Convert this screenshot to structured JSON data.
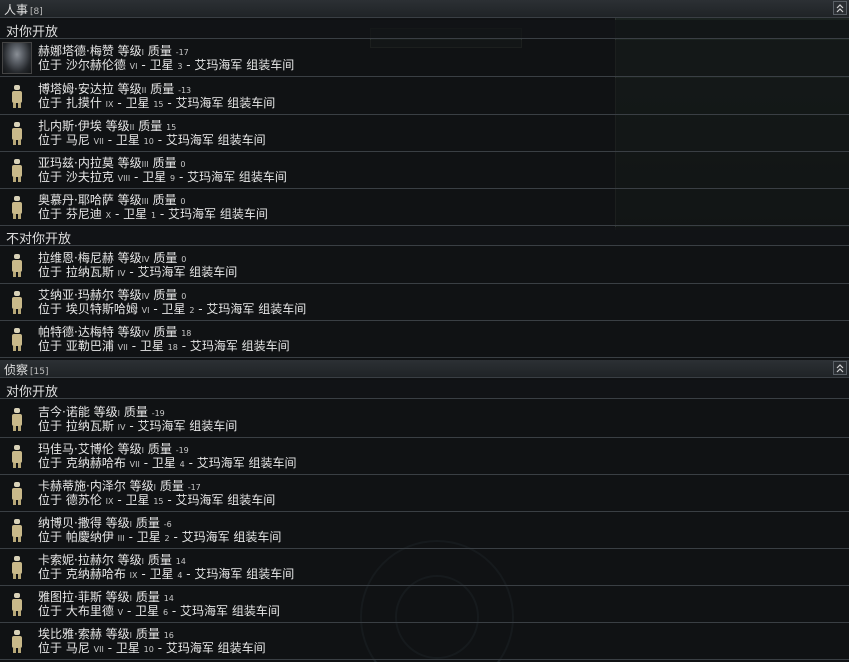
{
  "sections": [
    {
      "title": "人事",
      "count": "[8]",
      "groups": [
        {
          "label": "对你开放",
          "rows": [
            {
              "name": "赫娜塔德·梅赞",
              "lvl_label": "等级",
              "lvl": "I",
              "q_label": "质量",
              "q": "-17",
              "loc": "位于 沙尔赫伦德",
              "roman": "VI",
              "sat": "- 卫星",
              "satnum": "3",
              "tail": "- 艾玛海军 组装车间",
              "portrait": true
            },
            {
              "name": "博塔姆·安达拉",
              "lvl_label": "等级",
              "lvl": "II",
              "q_label": "质量",
              "q": "-13",
              "loc": "位于 扎摸什",
              "roman": "IX",
              "sat": "- 卫星",
              "satnum": "15",
              "tail": "- 艾玛海军 组装车间"
            },
            {
              "name": "扎内斯·伊埃",
              "lvl_label": "等级",
              "lvl": "II",
              "q_label": "质量",
              "q": "15",
              "loc": "位于 马尼",
              "roman": "VII",
              "sat": "- 卫星",
              "satnum": "10",
              "tail": "- 艾玛海军 组装车间"
            },
            {
              "name": "亚玛兹·内拉莫",
              "lvl_label": "等级",
              "lvl": "III",
              "q_label": "质量",
              "q": "0",
              "loc": "位于 沙夫拉克",
              "roman": "VIII",
              "sat": "- 卫星",
              "satnum": "9",
              "tail": "- 艾玛海军 组装车间"
            },
            {
              "name": "奥慕丹·耶哈萨",
              "lvl_label": "等级",
              "lvl": "III",
              "q_label": "质量",
              "q": "0",
              "loc": "位于 芬尼迪",
              "roman": "X",
              "sat": "- 卫星",
              "satnum": "1",
              "tail": "- 艾玛海军 组装车间"
            }
          ]
        },
        {
          "label": "不对你开放",
          "rows": [
            {
              "name": "拉维恩·梅尼赫",
              "lvl_label": "等级",
              "lvl": "IV",
              "q_label": "质量",
              "q": "0",
              "loc": "位于 拉纳瓦斯",
              "roman": "IV",
              "sat": "- 艾玛海军 组装车间",
              "satnum": "",
              "tail": ""
            },
            {
              "name": "艾纳亚·玛赫尔",
              "lvl_label": "等级",
              "lvl": "IV",
              "q_label": "质量",
              "q": "0",
              "loc": "位于 埃贝特斯哈姆",
              "roman": "VI",
              "sat": "- 卫星",
              "satnum": "2",
              "tail": "- 艾玛海军 组装车间"
            },
            {
              "name": "帕特德·达梅特",
              "lvl_label": "等级",
              "lvl": "IV",
              "q_label": "质量",
              "q": "18",
              "loc": "位于 亚勒巴浦",
              "roman": "VII",
              "sat": "- 卫星",
              "satnum": "18",
              "tail": "- 艾玛海军 组装车间"
            }
          ]
        }
      ]
    },
    {
      "title": "侦察",
      "count": "[15]",
      "groups": [
        {
          "label": "对你开放",
          "rows": [
            {
              "name": "吉今·诺能",
              "lvl_label": "等级",
              "lvl": "I",
              "q_label": "质量",
              "q": "-19",
              "loc": "位于 拉纳瓦斯",
              "roman": "IV",
              "sat": "- 艾玛海军 组装车间",
              "satnum": "",
              "tail": ""
            },
            {
              "name": "玛佳马·艾博伦",
              "lvl_label": "等级",
              "lvl": "I",
              "q_label": "质量",
              "q": "-19",
              "loc": "位于 克纳赫哈布",
              "roman": "VII",
              "sat": "- 卫星",
              "satnum": "4",
              "tail": "- 艾玛海军 组装车间"
            },
            {
              "name": "卡赫蒂施·内泽尔",
              "lvl_label": "等级",
              "lvl": "I",
              "q_label": "质量",
              "q": "-17",
              "loc": "位于 德苏伦",
              "roman": "IX",
              "sat": "- 卫星",
              "satnum": "15",
              "tail": "- 艾玛海军 组装车间"
            },
            {
              "name": "纳博贝·撒得",
              "lvl_label": "等级",
              "lvl": "I",
              "q_label": "质量",
              "q": "-6",
              "loc": "位于 帕慶纳伊",
              "roman": "III",
              "sat": "- 卫星",
              "satnum": "2",
              "tail": "- 艾玛海军 组装车间"
            },
            {
              "name": "卡索妮·拉赫尔",
              "lvl_label": "等级",
              "lvl": "I",
              "q_label": "质量",
              "q": "14",
              "loc": "位于 克纳赫哈布",
              "roman": "IX",
              "sat": "- 卫星",
              "satnum": "4",
              "tail": "- 艾玛海军 组装车间"
            },
            {
              "name": "雅图拉·菲斯",
              "lvl_label": "等级",
              "lvl": "I",
              "q_label": "质量",
              "q": "14",
              "loc": "位于 大布里德",
              "roman": "V",
              "sat": "- 卫星",
              "satnum": "6",
              "tail": "- 艾玛海军 组装车间"
            },
            {
              "name": "埃比雅·索赫",
              "lvl_label": "等级",
              "lvl": "I",
              "q_label": "质量",
              "q": "16",
              "loc": "位于 马尼",
              "roman": "VII",
              "sat": "- 卫星",
              "satnum": "10",
              "tail": "- 艾玛海军 组装车间"
            }
          ]
        }
      ]
    }
  ]
}
